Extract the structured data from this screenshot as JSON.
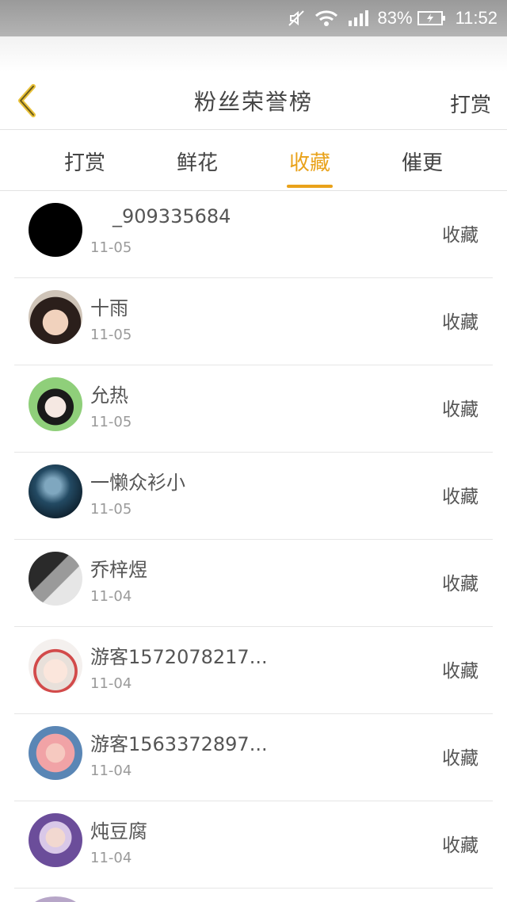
{
  "status_bar": {
    "battery_percent": "83%",
    "time": "11:52",
    "icons": [
      "mute-icon",
      "wifi-icon",
      "signal-icon",
      "battery-charging-icon"
    ]
  },
  "header": {
    "title": "粉丝荣誉榜",
    "right_action": "打赏",
    "back_icon": "chevron-left-icon",
    "accent_color": "#e9a21a"
  },
  "tabs": [
    {
      "label": "打赏",
      "active": false
    },
    {
      "label": "鲜花",
      "active": false
    },
    {
      "label": "收藏",
      "active": true
    },
    {
      "label": "催更",
      "active": false
    }
  ],
  "fans": [
    {
      "name": "_909335684",
      "date": "11-05",
      "action": "收藏"
    },
    {
      "name": "十雨",
      "date": "11-05",
      "action": "收藏"
    },
    {
      "name": "允热",
      "date": "11-05",
      "action": "收藏"
    },
    {
      "name": "一懒众衫小",
      "date": "11-05",
      "action": "收藏"
    },
    {
      "name": "乔梓煜",
      "date": "11-04",
      "action": "收藏"
    },
    {
      "name": "游客1572078217...",
      "date": "11-04",
      "action": "收藏"
    },
    {
      "name": "游客1563372897...",
      "date": "11-04",
      "action": "收藏"
    },
    {
      "name": "炖豆腐",
      "date": "11-04",
      "action": "收藏"
    }
  ]
}
